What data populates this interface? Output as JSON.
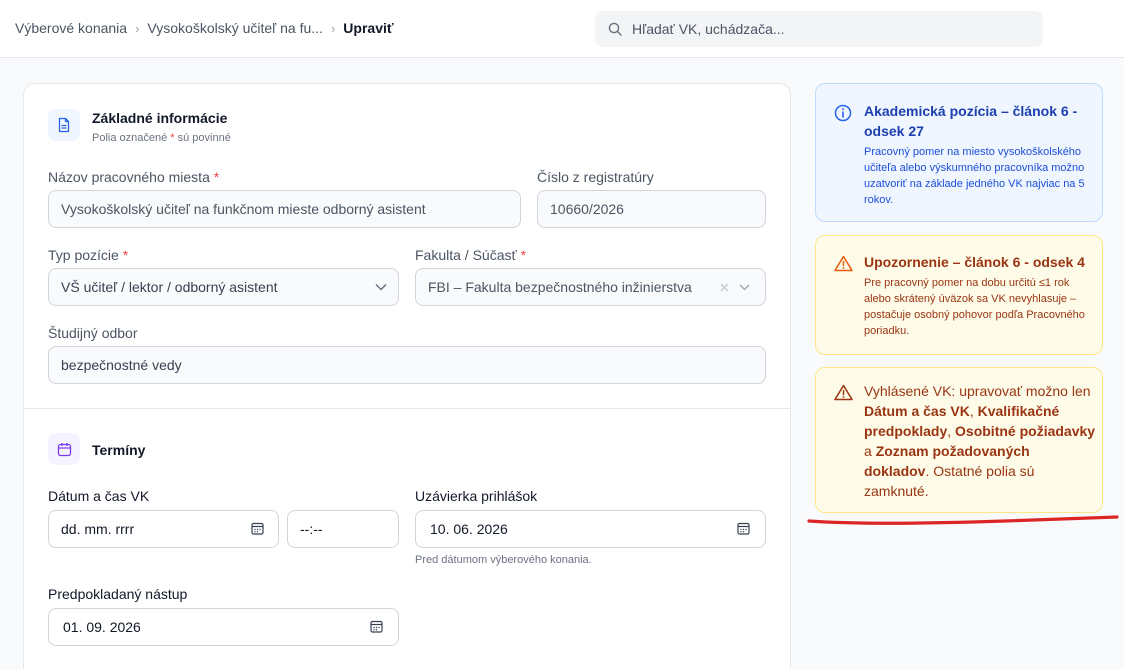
{
  "breadcrumb": {
    "items": [
      "Výberové konania",
      "Vysokoškolský učiteľ na fu...",
      "Upraviť"
    ],
    "separator": "›"
  },
  "search": {
    "placeholder": "Hľadať VK, uchádzača..."
  },
  "basic": {
    "title": "Základné informácie",
    "subtitle_pre": "Polia označené ",
    "required_mark": "*",
    "subtitle_post": " sú povinné",
    "position_label": "Názov pracovného miesta",
    "position_value": "Vysokoškolský učiteľ na funkčnom mieste odborný asistent",
    "registry_label": "Číslo z registratúry",
    "registry_value": "10660/2026",
    "type_label": "Typ pozície",
    "type_value": "VŠ učiteľ / lektor / odborný asistent",
    "faculty_label": "Fakulta / Súčasť",
    "faculty_value": "FBI – Fakulta bezpečnostného inžinierstva",
    "field_label": "Študijný odbor",
    "field_value": "bezpečnostné vedy"
  },
  "terms": {
    "title": "Termíny",
    "date_label": "Dátum a čas VK",
    "date_value": "dd. mm. rrrr",
    "time_value": "--:--",
    "deadline_label": "Uzávierka prihlášok",
    "deadline_value": "10. 06. 2026",
    "deadline_hint": "Pred dátumom výberového konania.",
    "start_label": "Predpokladaný nástup",
    "start_value": "01. 09. 2026"
  },
  "notices": {
    "academic_title": "Akademická pozícia – článok 6 - odsek 27",
    "academic_body": "Pracovný pomer na miesto vysokoškolského učiteľa alebo výskumného pracovníka možno uzatvoriť na základe jedného VK najviac na 5 rokov.",
    "warning_title": "Upozornenie – článok 6 - odsek 4",
    "warning_body": "Pre pracovný pomer na dobu určitú ≤1 rok alebo skrátený úväzok sa VK nevyhlasuje – postačuje osobný pohovor podľa Pracovného poriadku.",
    "locked_pre": "Vyhlásené VK: upravovať možno len ",
    "locked_b1": "Dátum a čas VK",
    "locked_c1": ", ",
    "locked_b2": "Kvalifikačné predpoklady",
    "locked_c2": ", ",
    "locked_b3": "Osobitné požiadavky",
    "locked_c3": " a ",
    "locked_b4": "Zoznam požadovaných dokladov",
    "locked_post": ". Ostatné polia sú zamknuté."
  },
  "colors": {
    "accent_blue": "#2563eb",
    "warning_orange": "#ea580c",
    "required_red": "#ef4444",
    "annotation_red": "#dc2626"
  }
}
